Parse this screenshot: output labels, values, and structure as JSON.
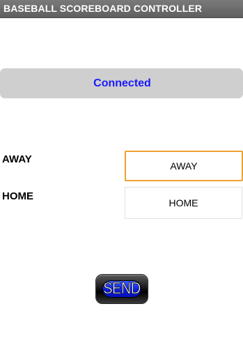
{
  "titlebar": {
    "title": "BASEBALL SCOREBOARD CONTROLLER"
  },
  "status": {
    "text": "Connected",
    "color": "#1a1aff"
  },
  "away": {
    "label": "AWAY",
    "field_value": "AWAY"
  },
  "home": {
    "label": "HOME",
    "field_value": "HOME"
  },
  "send_button": {
    "label": "SEND"
  },
  "colors": {
    "titlebar": "#6b6b6b",
    "status_bar": "#cfcfcf",
    "focused_border": "#f0a030",
    "send_blue": "#0a1ee0"
  }
}
